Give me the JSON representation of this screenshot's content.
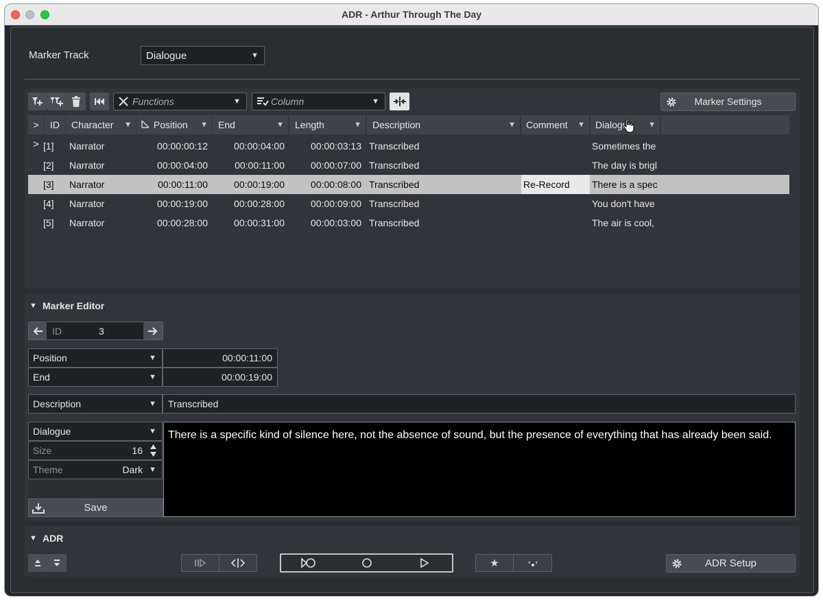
{
  "window": {
    "title": "ADR - Arthur Through The Day",
    "colors": {
      "close": "#ff5f57",
      "minimize": "#bdbdbd",
      "zoom": "#28c840"
    }
  },
  "marker_track": {
    "label": "Marker Track",
    "value": "Dialogue"
  },
  "toolbar": {
    "functions_placeholder": "Functions",
    "column_placeholder": "Column",
    "marker_settings_label": "Marker Settings"
  },
  "table": {
    "columns": [
      ">",
      "ID",
      "Character",
      "Position",
      "End",
      "Length",
      "Description",
      "Comment",
      "Dialogue"
    ],
    "rows": [
      {
        "expand": ">",
        "id": "[1]",
        "character": "Narrator",
        "position": "00:00:00:12",
        "end": "00:00:04:00",
        "length": "00:00:03:13",
        "description": "Transcribed",
        "comment": "",
        "dialogue": "Sometimes the"
      },
      {
        "expand": "",
        "id": "[2]",
        "character": "Narrator",
        "position": "00:00:04:00",
        "end": "00:00:11:00",
        "length": "00:00:07:00",
        "description": "Transcribed",
        "comment": "",
        "dialogue": "The day is brigl"
      },
      {
        "expand": "",
        "id": "[3]",
        "character": "Narrator",
        "position": "00:00:11:00",
        "end": "00:00:19:00",
        "length": "00:00:08:00",
        "description": "Transcribed",
        "comment": "Re-Record",
        "dialogue": "There is a spec"
      },
      {
        "expand": "",
        "id": "[4]",
        "character": "Narrator",
        "position": "00:00:19:00",
        "end": "00:00:28:00",
        "length": "00:00:09:00",
        "description": "Transcribed",
        "comment": "",
        "dialogue": "You don't have"
      },
      {
        "expand": "",
        "id": "[5]",
        "character": "Narrator",
        "position": "00:00:28:00",
        "end": "00:00:31:00",
        "length": "00:00:03:00",
        "description": "Transcribed",
        "comment": "",
        "dialogue": "The air is cool,"
      }
    ]
  },
  "marker_editor": {
    "title": "Marker Editor",
    "id_label": "ID",
    "id_value": "3",
    "position_label": "Position",
    "position_value": "00:00:11:00",
    "end_label": "End",
    "end_value": "00:00:19:00",
    "description_label": "Description",
    "description_value": "Transcribed",
    "dialogue_label": "Dialogue",
    "size_label": "Size",
    "size_value": "16",
    "theme_label": "Theme",
    "theme_value": "Dark",
    "save_label": "Save",
    "dialogue_text": "There is a specific kind of silence here, not the absence of sound, but the presence of everything that has already been said."
  },
  "adr": {
    "title": "ADR",
    "setup_label": "ADR Setup"
  }
}
